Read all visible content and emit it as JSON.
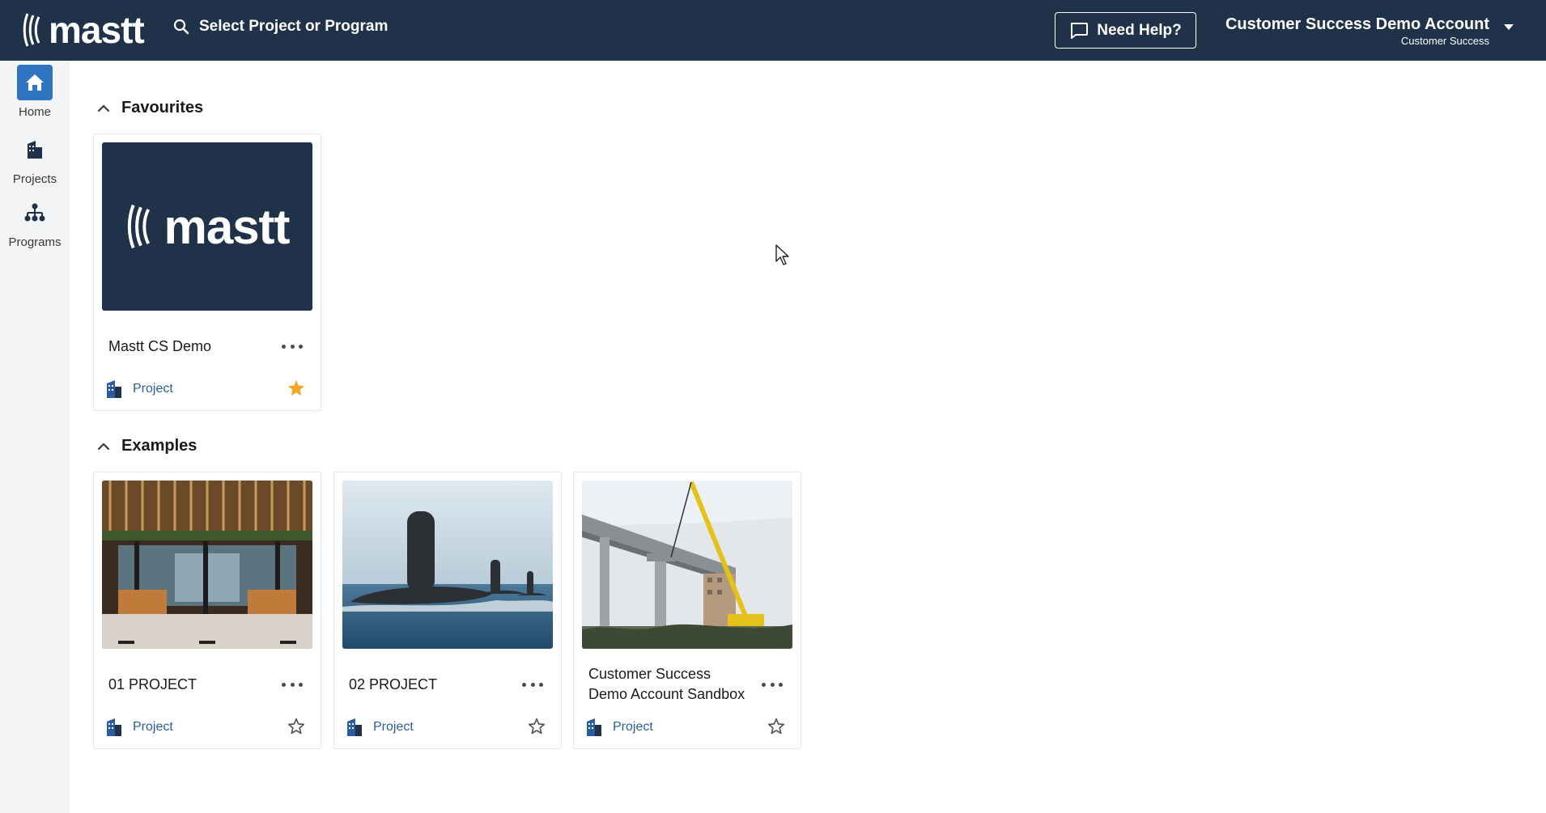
{
  "app": {
    "logo_text": "mastt",
    "search_label": "Select Project or Program",
    "help_label": "Need Help?",
    "account_name": "Customer Success Demo Account",
    "account_role": "Customer Success"
  },
  "sidebar": {
    "items": [
      {
        "label": "Home",
        "icon": "home-icon",
        "active": true
      },
      {
        "label": "Projects",
        "icon": "building-icon",
        "active": false
      },
      {
        "label": "Programs",
        "icon": "hierarchy-icon",
        "active": false
      }
    ]
  },
  "sections": [
    {
      "title": "Favourites",
      "cards": [
        {
          "title": "Mastt CS Demo",
          "logo_text": "mastt",
          "type": "Project",
          "favourite": true,
          "image": "mastt-logo"
        }
      ]
    },
    {
      "title": "Examples",
      "cards": [
        {
          "title": "01 PROJECT",
          "type": "Project",
          "favourite": false,
          "image": "restaurant-interior"
        },
        {
          "title": "02 PROJECT",
          "type": "Project",
          "favourite": false,
          "image": "submarine"
        },
        {
          "title": "Customer Success Demo Account Sandbox",
          "type": "Project",
          "favourite": false,
          "image": "crane-bridge"
        }
      ]
    }
  ],
  "colors": {
    "topbar": "#1f3249",
    "accent": "#2f74c0",
    "link": "#2a5d9f",
    "star": "#f5a623"
  }
}
